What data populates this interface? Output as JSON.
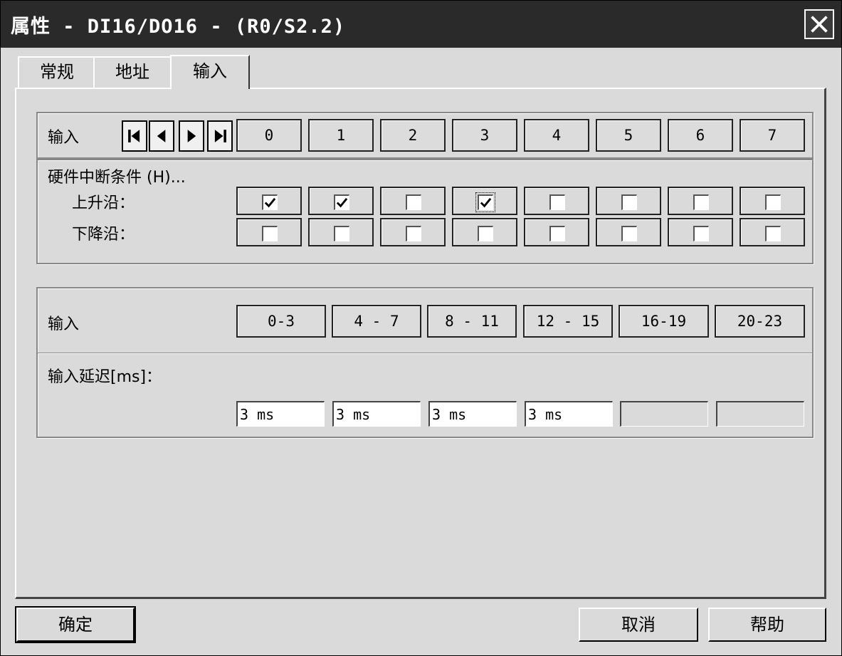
{
  "window": {
    "title": "属性 - DI16/DO16 - (R0/S2.2)",
    "close_icon": "close-icon"
  },
  "tabs": [
    "常规",
    "地址",
    "输入"
  ],
  "channels": {
    "label": "输入",
    "nav_icons": [
      "first-icon",
      "previous-icon",
      "next-icon",
      "last-icon"
    ],
    "columns": [
      "0",
      "1",
      "2",
      "3",
      "4",
      "5",
      "6",
      "7"
    ]
  },
  "hardware_interrupt": {
    "label": "硬件中断条件 (H)...",
    "rising_label": "上升沿：",
    "falling_label": "下降沿：",
    "rising": [
      true,
      true,
      false,
      true,
      false,
      false,
      false,
      false
    ],
    "falling": [
      false,
      false,
      false,
      false,
      false,
      false,
      false,
      false
    ]
  },
  "delay": {
    "groups_label": "输入",
    "groups": [
      "0-3",
      "4 - 7",
      "8 - 11",
      "12 - 15",
      "16-19",
      "20-23"
    ],
    "delay_label": "输入延迟[ms]：",
    "values": [
      "3 ms",
      "3 ms",
      "3 ms",
      "3 ms",
      "",
      ""
    ]
  },
  "buttons": {
    "ok": "确定",
    "cancel": "取消",
    "help": "帮助"
  }
}
